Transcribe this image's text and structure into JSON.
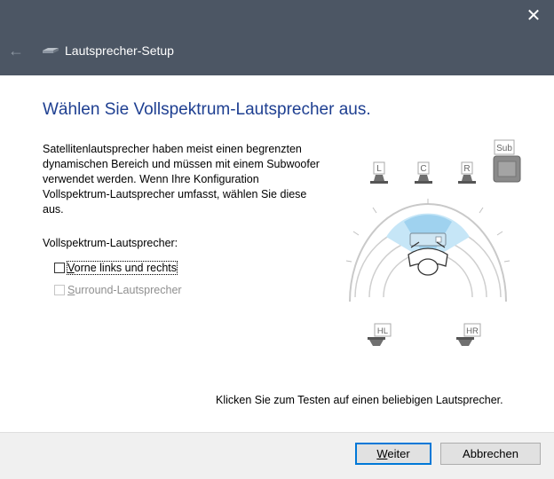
{
  "window": {
    "title": "Lautsprecher-Setup",
    "close_glyph": "✕",
    "back_glyph": "←"
  },
  "main": {
    "heading": "Wählen Sie Vollspektrum-Lautsprecher aus.",
    "description": "Satellitenlautsprecher haben meist einen begrenzten dynamischen Bereich und müssen mit einem Subwoofer verwendet werden. Wenn Ihre Konfiguration Vollspektrum-Lautsprecher umfasst, wählen Sie diese aus.",
    "group_label": "Vollspektrum-Lautsprecher:",
    "checkboxes": [
      {
        "access_key": "V",
        "rest": "orne links und rechts",
        "checked": false,
        "enabled": true
      },
      {
        "access_key": "S",
        "rest": "urround-Lautsprecher",
        "checked": false,
        "enabled": false
      }
    ],
    "hint": "Klicken Sie zum Testen auf einen beliebigen Lautsprecher."
  },
  "speakers": {
    "left": "L",
    "center": "C",
    "right": "R",
    "sub": "Sub",
    "rear_left": "HL",
    "rear_right": "HR"
  },
  "footer": {
    "next_key": "W",
    "next_rest": "eiter",
    "cancel": "Abbrechen"
  },
  "colors": {
    "titlebar": "#4c5664",
    "heading": "#1e3f91",
    "accent": "#0078d7",
    "diagram_blue": "#9fd2ef"
  },
  "icons": [
    "back-arrow-icon",
    "speaker-app-icon",
    "close-icon",
    "speaker-icon",
    "subwoofer-icon",
    "listener-icon"
  ]
}
